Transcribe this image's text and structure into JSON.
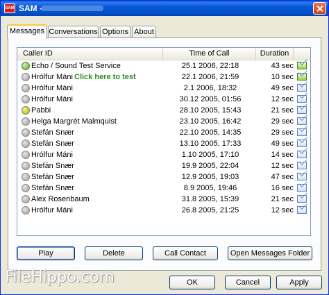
{
  "window": {
    "title": "SAM -",
    "icon": "sam-app-icon"
  },
  "tabs": [
    {
      "label": "Messages"
    },
    {
      "label": "Conversations"
    },
    {
      "label": "Options"
    },
    {
      "label": "About"
    }
  ],
  "list": {
    "columns": [
      "Caller ID",
      "Time of Call",
      "Duration"
    ],
    "hint": "Click here to test",
    "rows": [
      {
        "caller": "Echo / Sound Test Service",
        "time": "25.1 2006, 22:18",
        "duration": "43 sec",
        "icon": "green",
        "status": "new"
      },
      {
        "caller": "Hrólfur Máni",
        "time": "22.1 2006, 21:59",
        "duration": "10 sec",
        "icon": "gray",
        "status": "new"
      },
      {
        "caller": "Hrólfur Máni",
        "time": "2.1 2006, 18:32",
        "duration": "49 sec",
        "icon": "gray",
        "status": "read"
      },
      {
        "caller": "Hrólfur Máni",
        "time": "30.12 2005, 01:56",
        "duration": "12 sec",
        "icon": "gray",
        "status": "read"
      },
      {
        "caller": "Pabbi",
        "time": "28.10 2005, 15:43",
        "duration": "21 sec",
        "icon": "yellow",
        "status": "read"
      },
      {
        "caller": "Helga Margrét Malmquist",
        "time": "23.10 2005, 16:42",
        "duration": "29 sec",
        "icon": "gray",
        "status": "read"
      },
      {
        "caller": "Stefán Snær",
        "time": "22.10 2005, 14:35",
        "duration": "29 sec",
        "icon": "gray",
        "status": "read"
      },
      {
        "caller": "Stefán Snær",
        "time": "13.10 2005, 17:33",
        "duration": "49 sec",
        "icon": "gray",
        "status": "read"
      },
      {
        "caller": "Hrólfur Máni",
        "time": "1.10 2005, 17:10",
        "duration": "14 sec",
        "icon": "gray",
        "status": "read"
      },
      {
        "caller": "Stefán Snær",
        "time": "19.9 2005, 22:04",
        "duration": "12 sec",
        "icon": "gray",
        "status": "read"
      },
      {
        "caller": "Stefán Snær",
        "time": "12.9 2005, 19:03",
        "duration": "47 sec",
        "icon": "gray",
        "status": "read"
      },
      {
        "caller": "Stefán Snær",
        "time": "8.9 2005, 19:46",
        "duration": "16 sec",
        "icon": "gray",
        "status": "read"
      },
      {
        "caller": "Alex Rosenbaum",
        "time": "31.8 2005, 15:39",
        "duration": "21 sec",
        "icon": "gray",
        "status": "read"
      },
      {
        "caller": "Hrólfur Máni",
        "time": "26.8 2005, 21:25",
        "duration": "12 sec",
        "icon": "gray",
        "status": "read"
      }
    ]
  },
  "actions": {
    "play": "Play",
    "delete": "Delete",
    "call_contact": "Call Contact",
    "open_folder": "Open Messages Folder"
  },
  "dialog": {
    "ok": "OK",
    "cancel": "Cancel",
    "apply": "Apply"
  },
  "watermark": "FileHippo.com",
  "colors": {
    "titlebar": "#0a57d5",
    "hint": "#2b8a22",
    "tab_highlight": "#ffc83c"
  }
}
